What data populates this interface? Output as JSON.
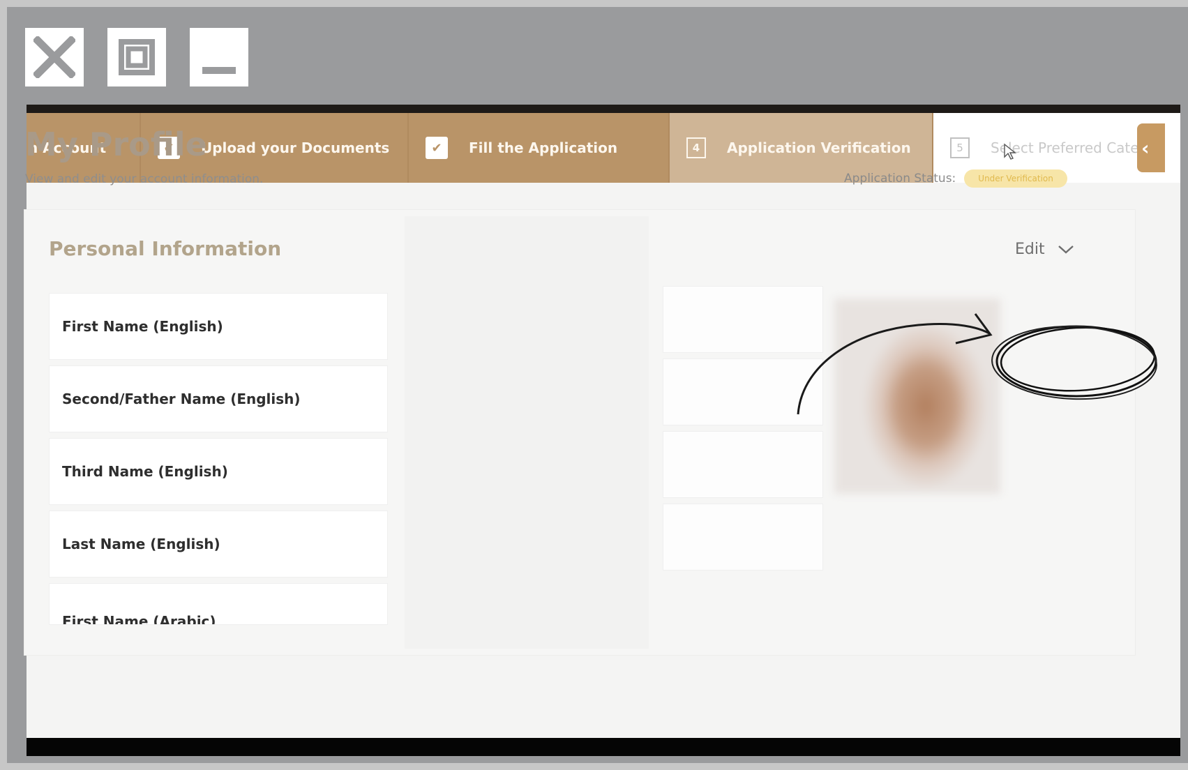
{
  "window_controls": {
    "close_icon": "close-icon",
    "maximize_icon": "maximize-icon",
    "minimize_icon": "minimize-icon"
  },
  "stepper": {
    "steps": [
      {
        "label": "n Account",
        "state": "done"
      },
      {
        "label": "Upload your Documents",
        "state": "done"
      },
      {
        "label": "Fill the Application",
        "state": "done"
      },
      {
        "label": "Application Verification",
        "state": "active",
        "number": "4"
      },
      {
        "label": "Select Preferred Catego",
        "state": "todo",
        "number": "5"
      }
    ]
  },
  "page": {
    "title": "My Profile",
    "subtitle": "View and edit your account information.",
    "status_label": "Application Status:",
    "status_value": "Under Verification"
  },
  "section": {
    "title": "Personal Information",
    "edit_label": "Edit",
    "fields": [
      "First Name (English)",
      "Second/Father Name (English)",
      "Third Name (English)",
      "Last Name (English)",
      "First Name (Arabic)"
    ]
  },
  "colors": {
    "step_done": "#b99468",
    "step_active": "#cfb596",
    "title": "#a99a88",
    "badge_bg": "#f7e5a8",
    "badge_text": "#e0b94d",
    "frame_bg": "#9a9b9d"
  }
}
